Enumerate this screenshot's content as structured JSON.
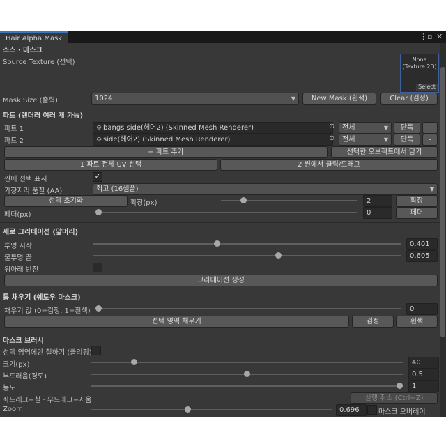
{
  "window": {
    "tab_title": "Hair Alpha Mask",
    "menu_icon": "kebab-menu-icon",
    "maximize_icon": "maximize-icon",
    "close_icon": "close-icon"
  },
  "source": {
    "header": "소스 · 마스크",
    "texture_label": "Source Texture (선택)",
    "texture_value": "None",
    "texture_type": "(Texture 2D)",
    "select_label": "Select",
    "mask_size_label": "Mask Size (출력)",
    "mask_size_value": "1024",
    "new_mask_button": "New Mask (흰색)",
    "clear_button": "Clear (검정)"
  },
  "parts": {
    "header": "파트 (렌더러 여러 개 가능)",
    "rows": [
      {
        "label": "파트 1",
        "object": "bangs side(헤어2) (Skinned Mesh Renderer)",
        "scope": "전체",
        "mode": "단독",
        "remove": "–"
      },
      {
        "label": "파트 2",
        "object": "side(헤어2) (Skinned Mesh Renderer)",
        "scope": "전체",
        "mode": "단독",
        "remove": "–"
      }
    ],
    "add_button": "+ 파트 추가",
    "load_selected_button": "선택한 오브젝트에서 담기",
    "select_all_uv_button": "1 파트 전체 UV 선택",
    "scene_click_button": "2 씬에서 클릭/드래그",
    "show_selection_label": "씬에 선택 표시",
    "show_selection_checked": true,
    "edge_quality_label": "가장자리 품질 (AA)",
    "edge_quality_value": "최고 (16샘플)",
    "reset_selection_button": "선택 초기화",
    "expand_label": "확장(px)",
    "expand_value": "2",
    "expand_fraction": 0.15,
    "expand_button": "확장",
    "feather_label": "페더(px)",
    "feather_value": "0",
    "feather_fraction": 0.0,
    "feather_button": "페더"
  },
  "gradient": {
    "header": "세로 그라데이션 (앞머리)",
    "transparent_start_label": "투명 시작",
    "transparent_start_value": "0.401",
    "transparent_start_fraction": 0.401,
    "opaque_end_label": "불투명 끝",
    "opaque_end_value": "0.605",
    "opaque_end_fraction": 0.605,
    "flip_label": "위아래 반전",
    "flip_checked": false,
    "generate_button": "그라데이션 생성"
  },
  "fill": {
    "header": "통 채우기 (쉐도우 마스크)",
    "fill_value_label": "채우기 값 (0=검정, 1=흰색)",
    "fill_value": "0",
    "fill_fraction": 0.0,
    "fill_selection_button": "선택 영역 채우기",
    "black_button": "검정",
    "white_button": "흰색"
  },
  "brush": {
    "header": "마스크 브러시",
    "paint_selection_only_label": "선택 영역에만 칠하기 (클리핑)",
    "paint_selection_only_checked": false,
    "size_label": "크기(px)",
    "size_value": "40",
    "size_fraction": 0.13,
    "softness_label": "부드러움(경도)",
    "softness_value": "0.5",
    "softness_fraction": 0.5,
    "density_label": "농도",
    "density_value": "1",
    "density_fraction": 1.0,
    "hint_label": "좌드래그=칠 · 우드래그=지움",
    "undo_button": "실행 취소 (Ctrl+Z)",
    "zoom_label": "Zoom",
    "zoom_value": "0.696",
    "zoom_fraction": 0.4,
    "overlay_label": "마스크 오버레이"
  }
}
